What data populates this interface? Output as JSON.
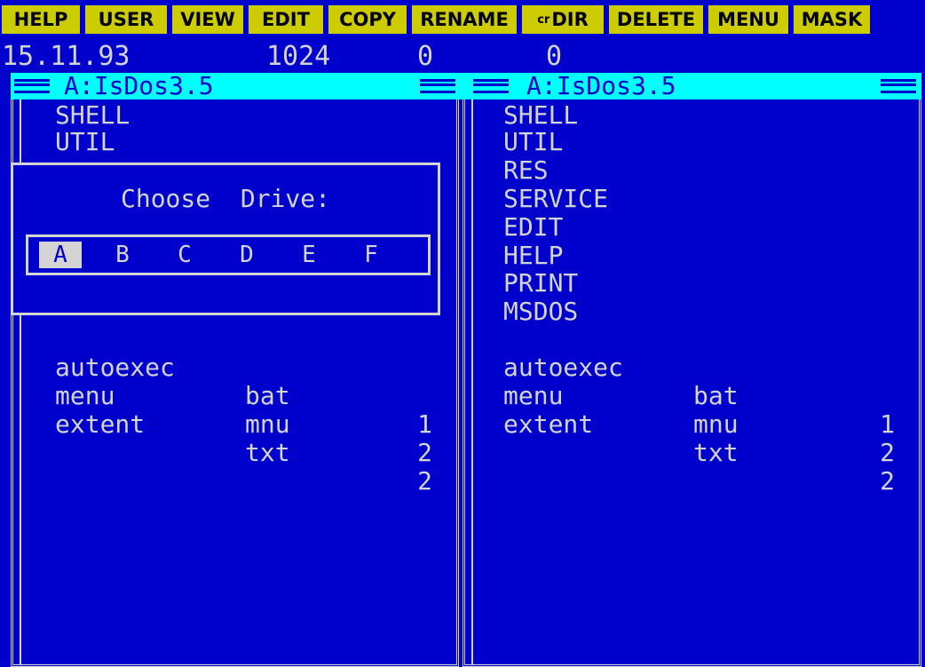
{
  "menu": [
    {
      "label": "HELP"
    },
    {
      "label": "USER"
    },
    {
      "label": "VIEW"
    },
    {
      "label": "EDIT"
    },
    {
      "label": "COPY"
    },
    {
      "label": "RENAME"
    },
    {
      "label": "DIR",
      "prefix": "cr"
    },
    {
      "label": "DELETE"
    },
    {
      "label": "MENU"
    },
    {
      "label": "MASK"
    }
  ],
  "status": {
    "date": "15.11.93",
    "free": "1024",
    "left_count": "0",
    "right_count": "0"
  },
  "left_panel": {
    "path": "A:IsDos3.5",
    "dirs": [
      "SHELL",
      "UTIL"
    ],
    "files": [
      {
        "name": "autoexec",
        "ext": "bat",
        "size": "1"
      },
      {
        "name": "menu",
        "ext": "mnu",
        "size": "2"
      },
      {
        "name": "extent",
        "ext": "txt",
        "size": "2"
      }
    ]
  },
  "right_panel": {
    "path": "A:IsDos3.5",
    "dirs": [
      "SHELL",
      "UTIL",
      "RES",
      "SERVICE",
      "EDIT",
      "HELP",
      "PRINT",
      "MSDOS"
    ],
    "files": [
      {
        "name": "autoexec",
        "ext": "bat",
        "size": "1"
      },
      {
        "name": "menu",
        "ext": "mnu",
        "size": "2"
      },
      {
        "name": "extent",
        "ext": "txt",
        "size": "2"
      }
    ]
  },
  "drive_dialog": {
    "title": "Choose  Drive:",
    "drives": [
      "A",
      "B",
      "C",
      "D",
      "E",
      "F"
    ],
    "selected": "A"
  },
  "colors": {
    "background": "#0000cc",
    "menu_bg": "#cccc00",
    "title_bg": "#00ffff",
    "text": "#d4d4d4"
  }
}
